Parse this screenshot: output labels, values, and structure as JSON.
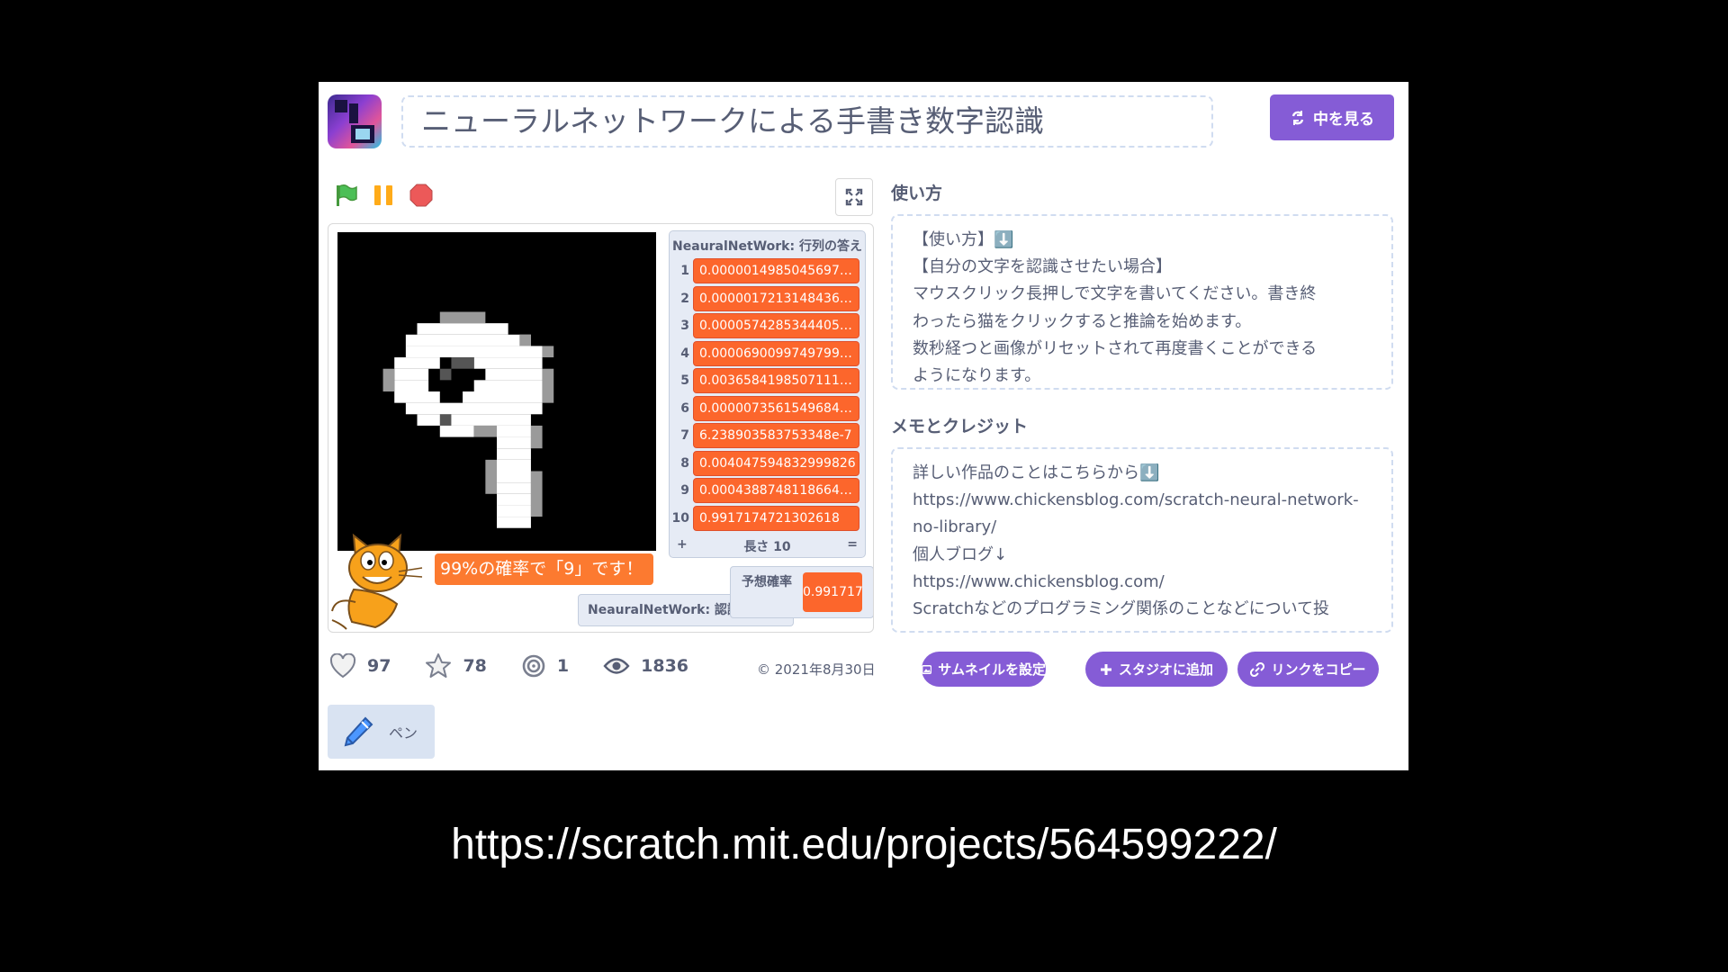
{
  "project": {
    "title": "ニューラルネットワークによる手書き数字認識",
    "see_inside_label": "中を見る"
  },
  "player": {
    "list_monitor": {
      "title": "NeauralNetWork: 行列の答え",
      "items": [
        {
          "index": "1",
          "value": "0.00000149850456976..."
        },
        {
          "index": "2",
          "value": "0.00000172131484369..."
        },
        {
          "index": "3",
          "value": "0.00005742853444056..."
        },
        {
          "index": "4",
          "value": "0.00006900997497991..."
        },
        {
          "index": "5",
          "value": "0.00365841985071119..."
        },
        {
          "index": "6",
          "value": "0.00000735615496844..."
        },
        {
          "index": "7",
          "value": "6.238903583753348e-7"
        },
        {
          "index": "8",
          "value": "0.004047594832999826"
        },
        {
          "index": "9",
          "value": "0.00043887481186641..."
        },
        {
          "index": "10",
          "value": "0.9917174721302618"
        }
      ],
      "add_symbol": "+",
      "length_label": "長さ 10",
      "resize_symbol": "="
    },
    "speech": "99%の確率で「9」です！",
    "monitor_recognition_label": "NeauralNetWork: 認識結果（%）",
    "monitor_prob": {
      "label": "予想確率",
      "value": "0.991717"
    }
  },
  "instructions": {
    "heading": "使い方",
    "lines": [
      "【使い方】⬇️",
      "【自分の文字を認識させたい場合】",
      "マウスクリック長押しで文字を書いてください。書き終",
      "わったら猫をクリックすると推論を始めます。",
      "数秒経つと画像がリセットされて再度書くことができる",
      "ようになります。"
    ]
  },
  "notes": {
    "heading": "メモとクレジット",
    "lines": [
      "詳しい作品のことはこちらから⬇️",
      "https://www.chickensblog.com/scratch-neural-network-",
      "no-library/",
      "個人ブログ↓",
      "https://www.chickensblog.com/",
      "Scratchなどのプログラミング関係のことなどについて投"
    ]
  },
  "stats": {
    "loves": "97",
    "favorites": "78",
    "remixes": "1",
    "views": "1836"
  },
  "date": "© 2021年8月30日",
  "actions": {
    "thumbnail": "サムネイルを設定",
    "studio": "スタジオに追加",
    "copy_link": "リンクをコピー"
  },
  "extension": {
    "label": "ペン"
  },
  "url": "https://scratch.mit.edu/projects/564599222/",
  "colors": {
    "purple": "#855cd6",
    "orange": "#fc662c",
    "text": "#575e75"
  },
  "icons": [
    "project-thumbnail-icon",
    "green-flag-icon",
    "pause-icon",
    "stop-icon",
    "fullscreen-icon",
    "heart-icon",
    "star-icon",
    "remix-icon",
    "eye-icon",
    "pen-icon"
  ]
}
